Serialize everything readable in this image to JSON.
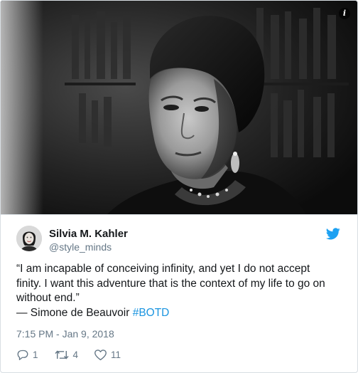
{
  "tweet": {
    "author_name": "Silvia M. Kahler",
    "author_handle": "@style_minds",
    "text_line1": "“I am incapable of conceiving infinity, and yet I do not accept",
    "text_line2": "finity. I want this adventure that is the context of my life to go on",
    "text_line3": "without end.”",
    "attribution": "— Simone de Beauvoir ",
    "hashtag": "#BOTD",
    "timestamp": "7:15 PM - Jan 9, 2018",
    "replies": "1",
    "retweets": "4",
    "likes": "11"
  },
  "icons": {
    "info": "info-icon",
    "brand": "twitter-bird-icon",
    "reply": "reply-icon",
    "retweet": "retweet-icon",
    "like": "heart-icon"
  },
  "colors": {
    "brand_blue": "#1da1f2",
    "hashtag": "#1b95e0",
    "secondary_text": "#657786",
    "primary_text": "#14171a"
  },
  "info_glyph": "i"
}
